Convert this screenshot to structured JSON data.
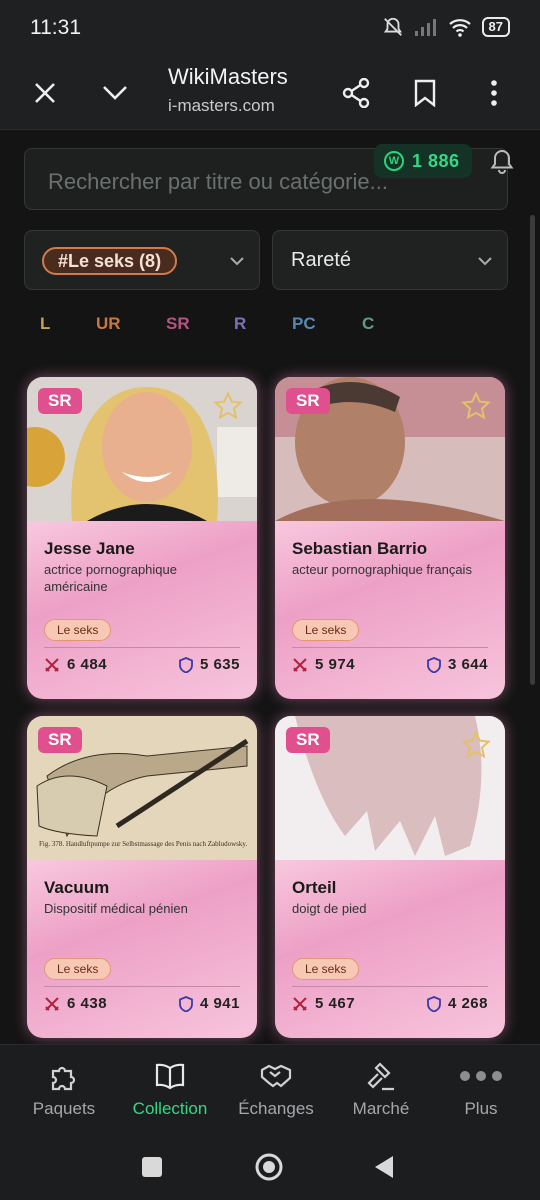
{
  "status_bar": {
    "time": "11:31",
    "battery": "87"
  },
  "browser": {
    "title": "WikiMasters",
    "url": "i-masters.com"
  },
  "search": {
    "placeholder": "Rechercher par titre ou catégorie..."
  },
  "wallet": {
    "coins": "1 886"
  },
  "filters": {
    "category_chip": "#Le seks (8)",
    "rarity_label": "Rareté"
  },
  "rarity_tabs": [
    {
      "label": "L",
      "color": "#c9a24a"
    },
    {
      "label": "UR",
      "color": "#c8793f"
    },
    {
      "label": "SR",
      "color": "#b35580"
    },
    {
      "label": "R",
      "color": "#7d72b8"
    },
    {
      "label": "PC",
      "color": "#5b86b0"
    },
    {
      "label": "C",
      "color": "#5f9c86"
    }
  ],
  "cards": [
    {
      "rarity": "SR",
      "name": "Jesse Jane",
      "desc": "actrice pornographique américaine",
      "tag": "Le seks",
      "attack": "6 484",
      "defense": "5 635"
    },
    {
      "rarity": "SR",
      "name": "Sebastian Barrio",
      "desc": "acteur pornographique français",
      "tag": "Le seks",
      "attack": "5 974",
      "defense": "3 644"
    },
    {
      "rarity": "SR",
      "name": "Vacuum",
      "desc": "Dispositif médical pénien",
      "tag": "Le seks",
      "attack": "6 438",
      "defense": "4 941",
      "image_caption": "Fig. 378. Handluftpumpe zur Selbstmassage des Penis nach Zabludowsky."
    },
    {
      "rarity": "SR",
      "name": "Orteil",
      "desc": "doigt de pied",
      "tag": "Le seks",
      "attack": "5 467",
      "defense": "4 268"
    }
  ],
  "bottom_nav": [
    {
      "label": "Paquets",
      "icon": "puzzle-icon"
    },
    {
      "label": "Collection",
      "icon": "book-icon",
      "active": true
    },
    {
      "label": "Échanges",
      "icon": "handshake-icon"
    },
    {
      "label": "Marché",
      "icon": "gavel-icon"
    },
    {
      "label": "Plus",
      "icon": "more-icon"
    }
  ],
  "colors": {
    "accent": "#35d884",
    "badge": "#e04f8e",
    "card_pink": "#f5b6d4"
  }
}
